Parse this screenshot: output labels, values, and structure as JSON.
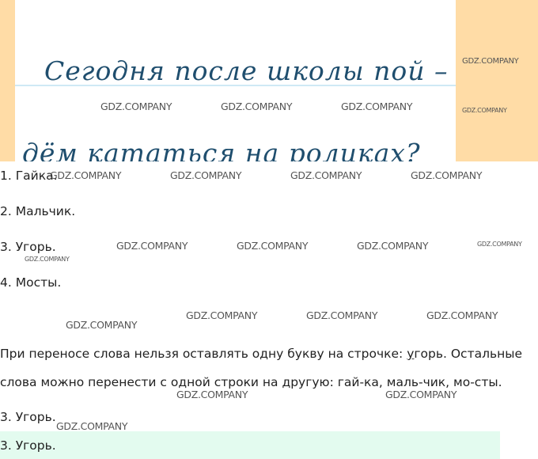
{
  "handwriting": {
    "line1": "Сегодня после школы пой –",
    "line2": "дём кататься на роликах?"
  },
  "answers": [
    {
      "text": "1. Гайка."
    },
    {
      "text": "2. Мальчик."
    },
    {
      "text": "3. Угорь."
    },
    {
      "text": "4. Мосты."
    }
  ],
  "explanation": {
    "before": "При переносе слова нельзя оставлять одну букву на строчке: ",
    "letter": "у",
    "after": "горь. Остальные",
    "line2": "слова можно перенести с одной строки на другую: гай-ка, маль-чик, мо-сты."
  },
  "result": "3. Угорь.",
  "result_highlight": "3. Угорь.",
  "watermark": "GDZ.COMPANY",
  "colors": {
    "margin": "#ffdca6",
    "highlight": "#e3fbef",
    "ink": "#1f4e6e"
  }
}
